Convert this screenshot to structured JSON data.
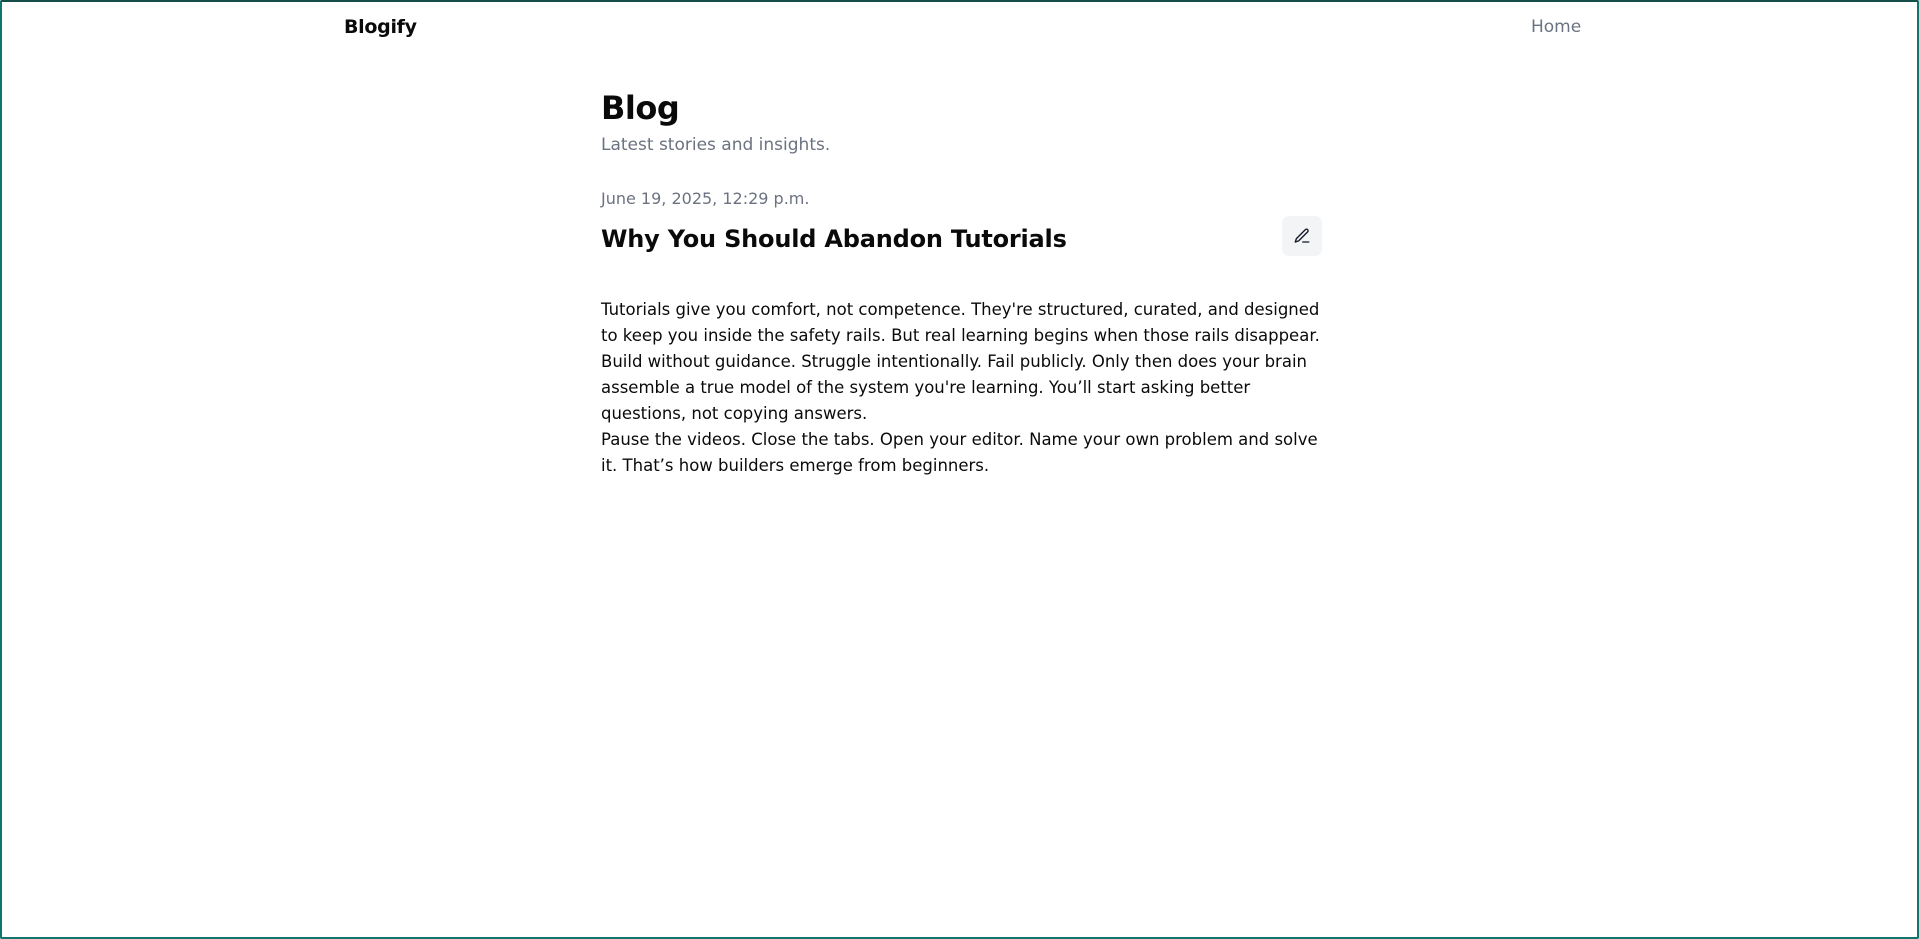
{
  "nav": {
    "brand": "Blogify",
    "links": [
      {
        "label": "Home"
      }
    ]
  },
  "page": {
    "title": "Blog",
    "subtitle": "Latest stories and insights."
  },
  "post": {
    "date": "June 19, 2025, 12:29 p.m.",
    "title": "Why You Should Abandon Tutorials",
    "edit_icon": "pencil-icon",
    "paragraphs": [
      "Tutorials give you comfort, not competence. They're structured, curated, and designed to keep you inside the safety rails. But real learning begins when those rails disappear.",
      "Build without guidance. Struggle intentionally. Fail publicly. Only then does your brain assemble a true model of the system you're learning. You’ll start asking better questions, not copying answers.",
      "Pause the videos. Close the tabs. Open your editor. Name your own problem and solve it. That’s how builders emerge from beginners."
    ]
  },
  "colors": {
    "text": "#0a0a0a",
    "muted": "#6b7280",
    "button_bg": "#f3f4f6",
    "frame_border": "#0f766e"
  }
}
